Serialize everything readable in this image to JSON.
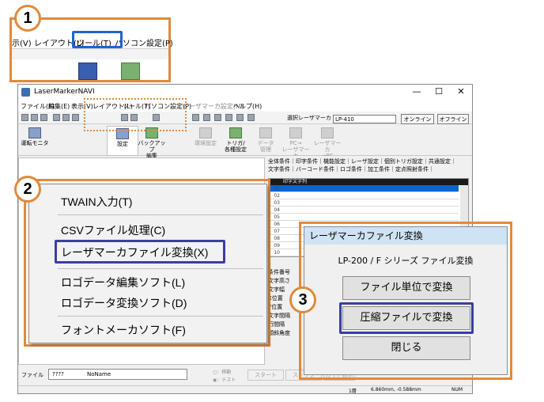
{
  "main_window": {
    "title": "LaserMarkerNAVI",
    "controls": [
      "—",
      "☐",
      "✕"
    ],
    "menu": [
      "ファイル(F)",
      "編集(E)",
      "表示(V)",
      "レイアウト(L)",
      "ツール(T)",
      "パソコン設定(P)",
      "レーザマーカ設定(M)",
      "ヘルプ(H)"
    ],
    "marker_label": "選択レーザマーカ",
    "marker_value": "LP-410",
    "online": "オンライン",
    "offline": "オフライン",
    "toolbar": {
      "monitor": "運転モニタ",
      "settings": "設定",
      "backup": "バックアップ\n編集",
      "env": "環境設定",
      "trigger": "トリガ/\n各種設定",
      "data_mgmt": "データ\n管理",
      "pc_to_laser": "PC→\nレーザマーカ",
      "laser_to_pc": "レーザマーカ\n→PC"
    },
    "tabs_row1": "全体条件｜印字条件｜機能設定｜レーザ設定｜個別トリガ設定｜共通設定｜",
    "tabs_row2": "文字条件｜バーコード条件｜ロゴ条件｜加工条件｜定点照射条件｜",
    "list_header": "印字文字列",
    "list_rows": [
      "01",
      "02",
      "03",
      "04",
      "05",
      "06",
      "07",
      "08",
      "09",
      "10"
    ],
    "side_labels": [
      "条件番号",
      "文字高さ",
      "文字幅",
      "X位置",
      "Y位置",
      "文字間隔",
      "行間隔",
      "傾斜角度"
    ],
    "bottom": {
      "file_label": "ファイル",
      "file_value": "????",
      "file_name": "NoName",
      "radio1": "：移動",
      "radio2": "：テスト",
      "start": "スタート",
      "stop": "ストップ",
      "guide": "ガイド表示"
    },
    "status": {
      "layer": "1層",
      "coords": "6.860mm, -0.588mm",
      "num": "NUM"
    }
  },
  "inset": {
    "badge": "1",
    "menu": [
      "示(V)",
      "レイアウト(L)",
      "ツール(T)",
      "パソコン設定(P)"
    ]
  },
  "tools_menu": {
    "badge": "2",
    "items": [
      "TWAIN入力(T)",
      "CSVファイル処理(C)",
      "レーザマーカファイル変換(X)",
      "ロゴデータ編集ソフト(L)",
      "ロゴデータ変換ソフト(D)",
      "フォントメーカソフト(F)"
    ]
  },
  "dialog": {
    "badge": "3",
    "title": "レーザマーカファイル変換",
    "subtitle": "LP-200 / F シリーズ  ファイル変換",
    "buttons": [
      "ファイル単位で変換",
      "圧縮ファイルで変換",
      "閉じる"
    ]
  },
  "colors": {
    "callout": "#e08a3c",
    "highlight_blue": "#1e64d2",
    "highlight_navy": "#3a3fa0"
  }
}
